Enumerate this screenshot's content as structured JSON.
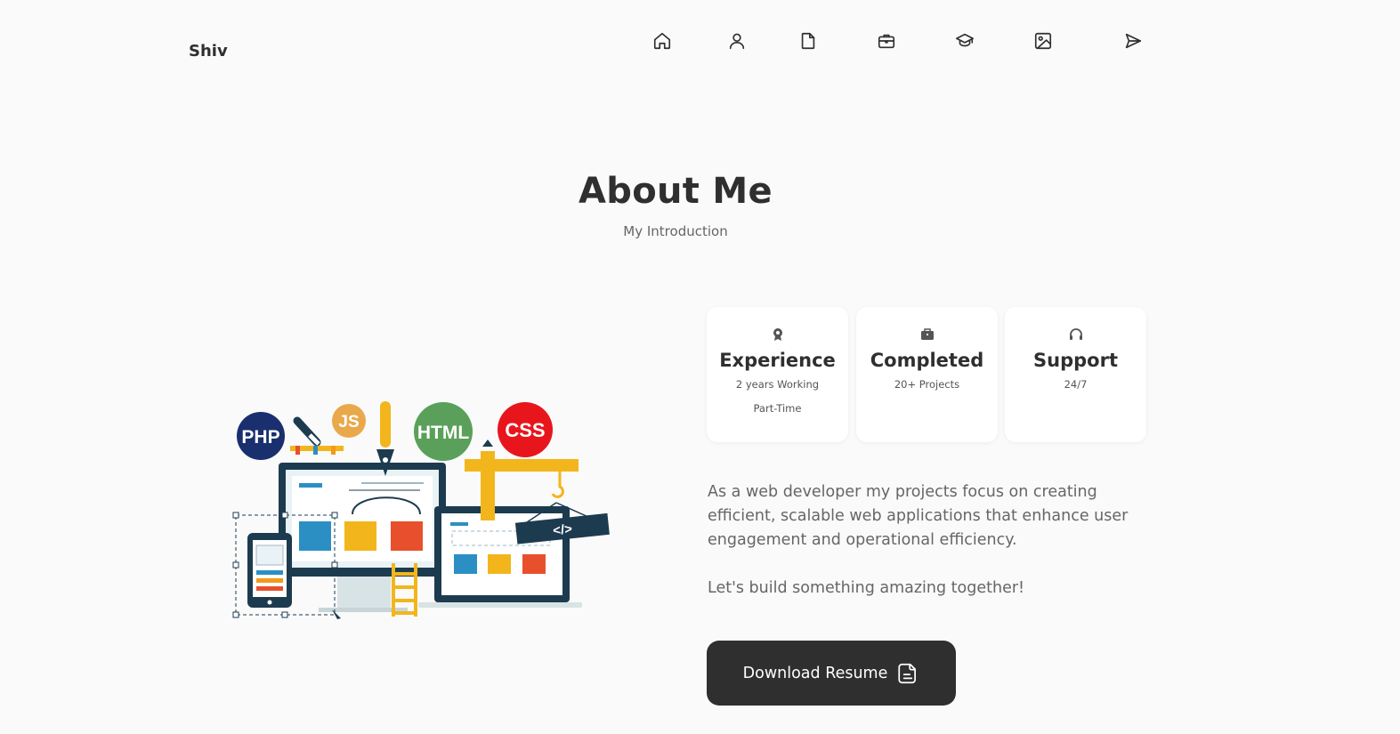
{
  "logo": "Shiv",
  "nav": [
    {
      "icon": "home-icon"
    },
    {
      "icon": "user-icon"
    },
    {
      "icon": "file-icon"
    },
    {
      "icon": "briefcase-icon"
    },
    {
      "icon": "graduation-cap-icon"
    },
    {
      "icon": "image-icon"
    },
    {
      "icon": "send-icon"
    }
  ],
  "section": {
    "title": "About Me",
    "subtitle": "My Introduction"
  },
  "illustration": {
    "badges": {
      "php": "PHP",
      "js": "JS",
      "html": "HTML",
      "css": "CSS",
      "code": "</>"
    },
    "colors": {
      "php": "#1a2f6e",
      "js": "#e9a94a",
      "html": "#5aa05a",
      "css": "#e8161c",
      "yellow": "#f2b61c",
      "navy": "#1d3b4f",
      "blue": "#2b8fc4",
      "orange": "#f39a1a",
      "red": "#e8502d"
    }
  },
  "cards": [
    {
      "icon": "award-icon",
      "title": "Experience",
      "line1": "2 years Working",
      "line2": "Part-Time"
    },
    {
      "icon": "briefcase-icon",
      "title": "Completed",
      "line1": "20+ Projects",
      "line2": ""
    },
    {
      "icon": "headset-icon",
      "title": "Support",
      "line1": "24/7",
      "line2": ""
    }
  ],
  "description": {
    "p1": "As a web developer my projects focus on creating efficient, scalable web applications that enhance user engagement and operational efficiency.",
    "p2": "Let's build something amazing together!"
  },
  "button": {
    "label": "Download Resume",
    "icon": "file-text-icon"
  },
  "colors": {
    "background": "#fafafa",
    "text": "#2f2f2f",
    "muted": "#666666",
    "button": "#2f2f2f",
    "card": "#ffffff"
  }
}
